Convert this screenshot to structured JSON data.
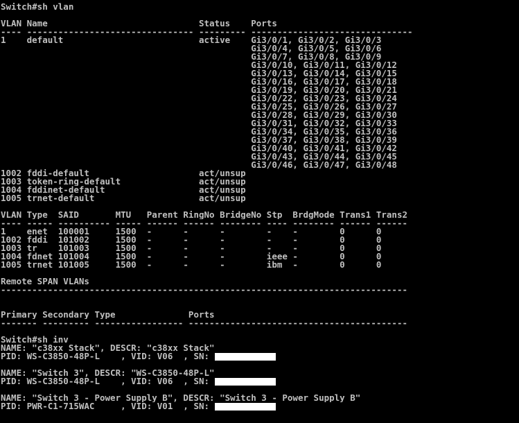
{
  "colors": {
    "background": "#000000",
    "text": "#c0c0c0",
    "redaction": "#ffffff"
  },
  "lines": [
    {
      "text": "Switch#sh vlan"
    },
    {
      "text": ""
    },
    {
      "text": "VLAN Name                             Status    Ports"
    },
    {
      "text": "---- -------------------------------- --------- -------------------------------"
    },
    {
      "text": "1    default                          active    Gi3/0/1, Gi3/0/2, Gi3/0/3"
    },
    {
      "text": "                                                Gi3/0/4, Gi3/0/5, Gi3/0/6"
    },
    {
      "text": "                                                Gi3/0/7, Gi3/0/8, Gi3/0/9"
    },
    {
      "text": "                                                Gi3/0/10, Gi3/0/11, Gi3/0/12"
    },
    {
      "text": "                                                Gi3/0/13, Gi3/0/14, Gi3/0/15"
    },
    {
      "text": "                                                Gi3/0/16, Gi3/0/17, Gi3/0/18"
    },
    {
      "text": "                                                Gi3/0/19, Gi3/0/20, Gi3/0/21"
    },
    {
      "text": "                                                Gi3/0/22, Gi3/0/23, Gi3/0/24"
    },
    {
      "text": "                                                Gi3/0/25, Gi3/0/26, Gi3/0/27"
    },
    {
      "text": "                                                Gi3/0/28, Gi3/0/29, Gi3/0/30"
    },
    {
      "text": "                                                Gi3/0/31, Gi3/0/32, Gi3/0/33"
    },
    {
      "text": "                                                Gi3/0/34, Gi3/0/35, Gi3/0/36"
    },
    {
      "text": "                                                Gi3/0/37, Gi3/0/38, Gi3/0/39"
    },
    {
      "text": "                                                Gi3/0/40, Gi3/0/41, Gi3/0/42"
    },
    {
      "text": "                                                Gi3/0/43, Gi3/0/44, Gi3/0/45"
    },
    {
      "text": "                                                Gi3/0/46, Gi3/0/47, Gi3/0/48"
    },
    {
      "text": "1002 fddi-default                     act/unsup"
    },
    {
      "text": "1003 token-ring-default               act/unsup"
    },
    {
      "text": "1004 fddinet-default                  act/unsup"
    },
    {
      "text": "1005 trnet-default                    act/unsup"
    },
    {
      "text": ""
    },
    {
      "text": "VLAN Type  SAID       MTU   Parent RingNo BridgeNo Stp  BrdgMode Trans1 Trans2"
    },
    {
      "text": "---- ----- ---------- ----- ------ ------ -------- ---- -------- ------ ------"
    },
    {
      "text": "1    enet  100001     1500  -      -      -        -    -        0      0"
    },
    {
      "text": "1002 fddi  101002     1500  -      -      -        -    -        0      0"
    },
    {
      "text": "1003 tr    101003     1500  -      -      -        -    -        0      0"
    },
    {
      "text": "1004 fdnet 101004     1500  -      -      -        ieee -        0      0"
    },
    {
      "text": "1005 trnet 101005     1500  -      -      -        ibm  -        0      0"
    },
    {
      "text": ""
    },
    {
      "text": "Remote SPAN VLANs"
    },
    {
      "text": "------------------------------------------------------------------------------"
    },
    {
      "text": ""
    },
    {
      "text": ""
    },
    {
      "text": "Primary Secondary Type              Ports"
    },
    {
      "text": "------- --------- ----------------- ------------------------------------------"
    },
    {
      "text": ""
    },
    {
      "text": "Switch#sh inv"
    },
    {
      "text": "NAME: \"c38xx Stack\", DESCR: \"c38xx Stack\""
    },
    {
      "text": "PID: WS-C3850-48P-L    , VID: V06  , SN: ",
      "redacted": true
    },
    {
      "text": ""
    },
    {
      "text": "NAME: \"Switch 3\", DESCR: \"WS-C3850-48P-L\""
    },
    {
      "text": "PID: WS-C3850-48P-L    , VID: V06  , SN: ",
      "redacted": true
    },
    {
      "text": ""
    },
    {
      "text": "NAME: \"Switch 3 - Power Supply B\", DESCR: \"Switch 3 - Power Supply B\""
    },
    {
      "text": "PID: PWR-C1-715WAC     , VID: V01  , SN: ",
      "redacted": true
    }
  ]
}
